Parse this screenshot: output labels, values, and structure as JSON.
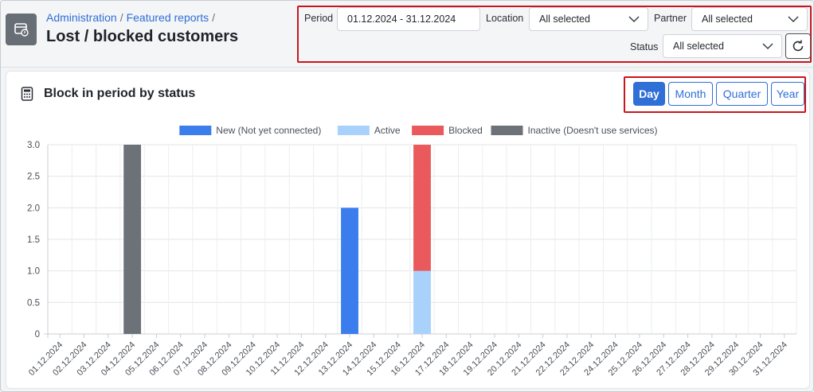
{
  "breadcrumb": {
    "items": [
      "Administration",
      "Featured reports"
    ],
    "trailing_sep": "/"
  },
  "page_title": "Lost / blocked customers",
  "filters": {
    "period_label": "Period",
    "period_value": "01.12.2024 - 31.12.2024",
    "location_label": "Location",
    "location_value": "All selected",
    "partner_label": "Partner",
    "partner_value": "All selected",
    "status_label": "Status",
    "status_value": "All selected"
  },
  "card": {
    "title": "Block in period by status",
    "period_buttons": [
      "Day",
      "Month",
      "Quarter",
      "Year"
    ],
    "active_period": "Day"
  },
  "colors": {
    "accent": "#2f6fd6",
    "highlight_border": "#c8161d"
  },
  "chart_data": {
    "type": "bar",
    "stacked": true,
    "title": "",
    "xlabel": "",
    "ylabel": "",
    "ylim": [
      0,
      3
    ],
    "yticks": [
      "3.0",
      "2.5",
      "2.0",
      "1.5",
      "1.0",
      "0.5",
      "0"
    ],
    "legend_position": "top",
    "grid": true,
    "categories": [
      "01.12.2024",
      "02.12.2024",
      "03.12.2024",
      "04.12.2024",
      "05.12.2024",
      "06.12.2024",
      "07.12.2024",
      "08.12.2024",
      "09.12.2024",
      "10.12.2024",
      "11.12.2024",
      "12.12.2024",
      "13.12.2024",
      "14.12.2024",
      "15.12.2024",
      "16.12.2024",
      "17.12.2024",
      "18.12.2024",
      "19.12.2024",
      "20.12.2024",
      "21.12.2024",
      "22.12.2024",
      "23.12.2024",
      "24.12.2024",
      "25.12.2024",
      "26.12.2024",
      "27.12.2024",
      "28.12.2024",
      "29.12.2024",
      "30.12.2024",
      "31.12.2024"
    ],
    "series": [
      {
        "name": "New (Not yet connected)",
        "color": "#3b7ded",
        "values": [
          0,
          0,
          0,
          0,
          0,
          0,
          0,
          0,
          0,
          0,
          0,
          0,
          2,
          0,
          0,
          0,
          0,
          0,
          0,
          0,
          0,
          0,
          0,
          0,
          0,
          0,
          0,
          0,
          0,
          0,
          0
        ]
      },
      {
        "name": "Active",
        "color": "#a8d1fb",
        "values": [
          0,
          0,
          0,
          0,
          0,
          0,
          0,
          0,
          0,
          0,
          0,
          0,
          0,
          0,
          0,
          1,
          0,
          0,
          0,
          0,
          0,
          0,
          0,
          0,
          0,
          0,
          0,
          0,
          0,
          0,
          0
        ]
      },
      {
        "name": "Blocked",
        "color": "#ea5a5c",
        "values": [
          0,
          0,
          0,
          0,
          0,
          0,
          0,
          0,
          0,
          0,
          0,
          0,
          0,
          0,
          0,
          2,
          0,
          0,
          0,
          0,
          0,
          0,
          0,
          0,
          0,
          0,
          0,
          0,
          0,
          0,
          0
        ]
      },
      {
        "name": "Inactive (Doesn't use services)",
        "color": "#6c7278",
        "values": [
          0,
          0,
          0,
          3,
          0,
          0,
          0,
          0,
          0,
          0,
          0,
          0,
          0,
          0,
          0,
          0,
          0,
          0,
          0,
          0,
          0,
          0,
          0,
          0,
          0,
          0,
          0,
          0,
          0,
          0,
          0
        ]
      }
    ]
  }
}
